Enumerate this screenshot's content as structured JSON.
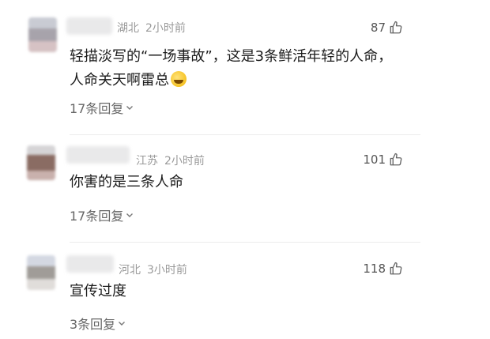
{
  "comments": [
    {
      "location": "湖北",
      "time": "2小时前",
      "likes": "87",
      "text_line1": "轻描淡写的“一场事故”，这是3条鲜活年轻的人命，",
      "text_line2": "人命关天啊雷总",
      "emoji": "laughing-crying-face",
      "replies": "17条回复"
    },
    {
      "location": "江苏",
      "time": "2小时前",
      "likes": "101",
      "text_line1": "你害的是三条人命",
      "replies": "17条回复"
    },
    {
      "location": "河北",
      "time": "3小时前",
      "likes": "118",
      "text_line1": "宣传过度",
      "replies": "3条回复"
    }
  ],
  "colors": {
    "meta": "#9a9a9a",
    "text": "#1c1c1c",
    "divider": "#ececec"
  }
}
